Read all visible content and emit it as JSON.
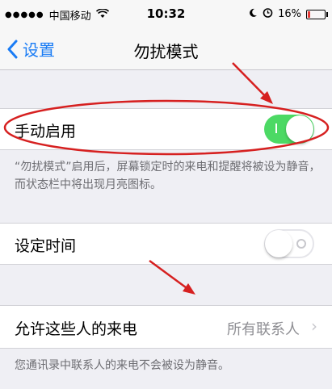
{
  "status_bar": {
    "signal": "●●●●●",
    "carrier": "中国移动",
    "wifi_icon": "wifi-icon",
    "time": "10:32",
    "battery_percent": "16%",
    "battery_level": 0.16,
    "colors": {
      "battery_low": "#e53935"
    }
  },
  "nav": {
    "back_label": "设置",
    "title": "勿扰模式"
  },
  "manual": {
    "label": "手动启用",
    "toggle_on": true,
    "footnote": "“勿扰模式”启用后，屏幕锁定时的来电和提醒将被设为静音，而状态栏中将出现月亮图标。"
  },
  "scheduled": {
    "label": "设定时间",
    "toggle_on": false
  },
  "allow_calls": {
    "label": "允许这些人的来电",
    "value": "所有联系人",
    "footnote": "您通讯录中联系人的来电不会被设为静音。"
  },
  "colors": {
    "accent": "#1a7cf5",
    "toggle_on": "#4cd964",
    "annotation": "#d62020"
  }
}
